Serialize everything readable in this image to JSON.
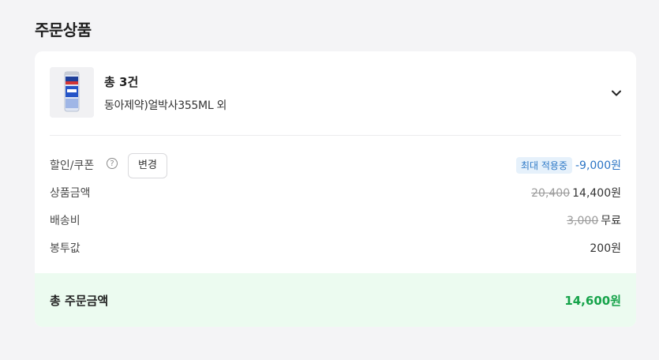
{
  "section": {
    "title": "주문상품"
  },
  "product": {
    "thumbnail_icon": "beverage-can-icon",
    "count_label": "총 3건",
    "name": "동아제약)얼박사355ML 외",
    "expand_icon": "chevron-down-icon"
  },
  "summary": {
    "discount": {
      "label": "할인/쿠폰",
      "info_icon": "?",
      "change_label": "변경",
      "badge": "최대 적용중",
      "value": "-9,000원"
    },
    "product_amount": {
      "label": "상품금액",
      "original": "20,400",
      "value": "14,400원"
    },
    "shipping": {
      "label": "배송비",
      "original": "3,000",
      "value": "무료"
    },
    "bag_fee": {
      "label": "봉투값",
      "value": "200원"
    }
  },
  "total": {
    "label": "총 주문금액",
    "value": "14,600원"
  },
  "colors": {
    "background": "#f4f4f6",
    "card": "#ffffff",
    "total_bg": "#ecfbf0",
    "total_value": "#16a34a",
    "discount_blue": "#2b74c4",
    "badge_bg": "#e6f1fb"
  }
}
